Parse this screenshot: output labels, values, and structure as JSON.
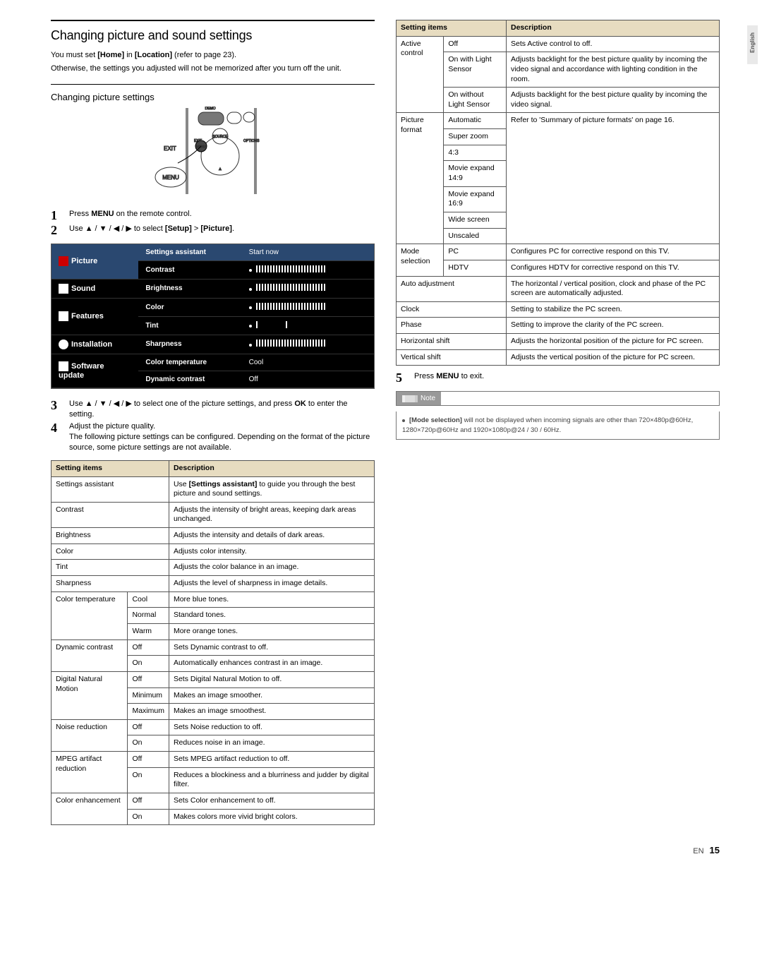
{
  "sidebar": {
    "lang": "English"
  },
  "title": "Changing picture and sound settings",
  "intro1a": "You must set ",
  "intro1b": "[Home]",
  "intro1c": " in ",
  "intro1d": "[Location]",
  "intro1e": " (refer to page 23).",
  "intro2": "Otherwise, the settings you adjusted will not be memorized after you turn off the unit.",
  "sub1": "Changing picture settings",
  "remote": {
    "demo": "DEMO",
    "exit_big": "EXIT",
    "exit_small": "EXIT",
    "menu_big": "MENU",
    "menu_small": "MENU",
    "src": "SOURCE",
    "opt": "OPTIONS",
    "up": "▲"
  },
  "step1a": "Press ",
  "step1b": "MENU",
  "step1c": " on the remote control.",
  "step2a": "Use ▲ / ▼ / ◀ / ▶ to select ",
  "step2b": "[Setup]",
  "step2c": " > ",
  "step2d": "[Picture]",
  "step2e": ".",
  "menu": {
    "side0": "Picture",
    "side1": "Sound",
    "side2": "Features",
    "side3": "Installation",
    "side4": "Software update",
    "r0l": "Settings assistant",
    "r0v": "Start now",
    "r1l": "Contrast",
    "r2l": "Brightness",
    "r3l": "Color",
    "r4l": "Tint",
    "r5l": "Sharpness",
    "r6l": "Color temperature",
    "r6v": "Cool",
    "r7l": "Dynamic contrast",
    "r7v": "Off"
  },
  "step3a": "Use ▲ / ▼ / ◀ / ▶ to select one of the picture settings, and press ",
  "step3b": "OK",
  "step3c": " to enter the setting.",
  "step4a": "Adjust the picture quality.",
  "step4b": "The following picture settings can be configured. Depending on the format of the picture source, some picture settings are not available.",
  "t1": {
    "h1": "Setting items",
    "h2": "Description",
    "r": [
      {
        "a": "Settings assistant",
        "d": "Use [Settings assistant] to guide you through the best picture and sound settings.",
        "bold": "[Settings assistant]"
      },
      {
        "a": "Contrast",
        "d": "Adjusts the intensity of bright areas, keeping dark areas unchanged."
      },
      {
        "a": "Brightness",
        "d": "Adjusts the intensity and details of dark areas."
      },
      {
        "a": "Color",
        "d": "Adjusts color intensity."
      },
      {
        "a": "Tint",
        "d": "Adjusts the color balance in an image."
      },
      {
        "a": "Sharpness",
        "d": "Adjusts the level of sharpness in image details."
      }
    ],
    "ct": {
      "a": "Color temperature",
      "o": [
        [
          "Cool",
          "More blue tones."
        ],
        [
          "Normal",
          "Standard tones."
        ],
        [
          "Warm",
          "More orange tones."
        ]
      ]
    },
    "dc": {
      "a": "Dynamic contrast",
      "o": [
        [
          "Off",
          "Sets Dynamic contrast to off."
        ],
        [
          "On",
          "Automatically enhances contrast in an image."
        ]
      ]
    },
    "dn": {
      "a": "Digital Natural Motion",
      "o": [
        [
          "Off",
          "Sets Digital Natural Motion to off."
        ],
        [
          "Minimum",
          "Makes an image smoother."
        ],
        [
          "Maximum",
          "Makes an image smoothest."
        ]
      ]
    },
    "nr": {
      "a": "Noise reduction",
      "o": [
        [
          "Off",
          "Sets Noise reduction to off."
        ],
        [
          "On",
          "Reduces noise in an image."
        ]
      ]
    },
    "ma": {
      "a": "MPEG artifact reduction",
      "o": [
        [
          "Off",
          "Sets MPEG artifact reduction to off."
        ],
        [
          "On",
          "Reduces a blockiness and a blurriness and judder by digital filter."
        ]
      ]
    },
    "ce": {
      "a": "Color enhancement",
      "o": [
        [
          "Off",
          "Sets Color enhancement to off."
        ],
        [
          "On",
          "Makes colors more vivid bright colors."
        ]
      ]
    }
  },
  "t2": {
    "h1": "Setting items",
    "h2": "Description",
    "ac": {
      "a": "Active control",
      "o": [
        [
          "Off",
          "Sets Active control to off."
        ],
        [
          "On with Light Sensor",
          "Adjusts backlight for the best picture quality by incoming the video signal and accordance with lighting condition in the room."
        ],
        [
          "On without Light Sensor",
          "Adjusts backlight for the best picture quality by incoming the video signal."
        ]
      ]
    },
    "pf": {
      "a": "Picture format",
      "d": "Refer to 'Summary of picture formats' on page 16.",
      "opts": [
        "Automatic",
        "Super zoom",
        "4:3",
        "Movie expand 14:9",
        "Movie expand 16:9",
        "Wide screen",
        "Unscaled"
      ]
    },
    "ms": {
      "a": "Mode selection",
      "o": [
        [
          "PC",
          "Configures PC for corrective respond on this TV."
        ],
        [
          "HDTV",
          "Configures HDTV for corrective respond on this TV."
        ]
      ]
    },
    "aa": {
      "a": "Auto adjustment",
      "d": "The horizontal / vertical position, clock and phase of the PC screen are automatically adjusted."
    },
    "ck": {
      "a": "Clock",
      "d": "Setting to stabilize the PC screen."
    },
    "ph": {
      "a": "Phase",
      "d": "Setting to improve the clarity of the PC screen."
    },
    "hs": {
      "a": "Horizontal shift",
      "d": "Adjusts the horizontal position of the picture for PC screen."
    },
    "vs": {
      "a": "Vertical shift",
      "d": "Adjusts the vertical position of the picture for PC screen."
    }
  },
  "step5a": "Press ",
  "step5b": "MENU",
  "step5c": " to exit.",
  "note": {
    "label": "Note",
    "b": "[Mode selection]",
    "t": " will not be displayed when incoming signals are other than 720×480p@60Hz, 1280×720p@60Hz and 1920×1080p@24 / 30 / 60Hz."
  },
  "footer": {
    "en": "EN",
    "pg": "15"
  }
}
